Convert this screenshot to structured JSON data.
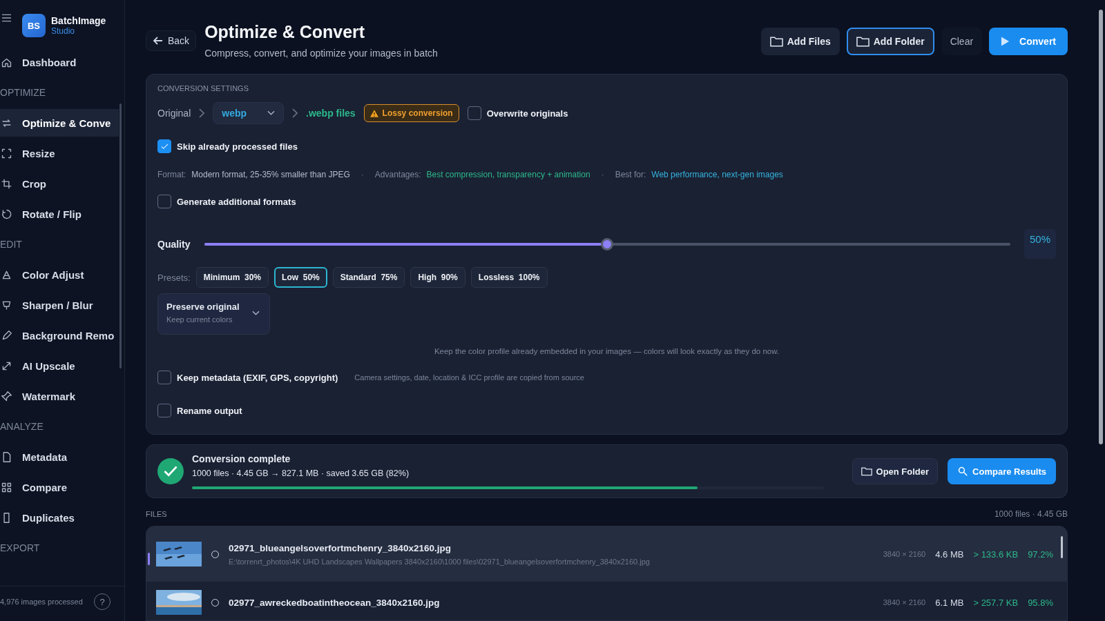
{
  "sidebar": {
    "brand": {
      "initials": "BS",
      "name": "BatchImage",
      "subtitle": "Studio"
    },
    "items": [
      {
        "kind": "item",
        "label": "Dashboard",
        "selected": false
      },
      {
        "kind": "section",
        "label": "OPTIMIZE"
      },
      {
        "kind": "item",
        "label": "Optimize & Conve",
        "selected": true
      },
      {
        "kind": "item",
        "label": "Resize",
        "selected": false
      },
      {
        "kind": "item",
        "label": "Crop",
        "selected": false
      },
      {
        "kind": "item",
        "label": "Rotate / Flip",
        "selected": false
      },
      {
        "kind": "section",
        "label": "EDIT"
      },
      {
        "kind": "item",
        "label": "Color Adjust",
        "selected": false
      },
      {
        "kind": "item",
        "label": "Sharpen / Blur",
        "selected": false
      },
      {
        "kind": "item",
        "label": "Background Remo",
        "selected": false
      },
      {
        "kind": "item",
        "label": "AI Upscale",
        "selected": false
      },
      {
        "kind": "item",
        "label": "Watermark",
        "selected": false
      },
      {
        "kind": "section",
        "label": "ANALYZE"
      },
      {
        "kind": "item",
        "label": "Metadata",
        "selected": false
      },
      {
        "kind": "item",
        "label": "Compare",
        "selected": false
      },
      {
        "kind": "item",
        "label": "Duplicates",
        "selected": false
      },
      {
        "kind": "section",
        "label": "EXPORT"
      }
    ],
    "footer": "4,976 images processed",
    "help": "?"
  },
  "header": {
    "back": "Back",
    "title": "Optimize & Convert",
    "subtitle": "Compress, convert, and optimize your images in batch",
    "buttons": [
      {
        "kind": "secondary",
        "label": "Add Files"
      },
      {
        "kind": "outlined",
        "label": "Add Folder"
      },
      {
        "kind": "ghost",
        "label": "Clear"
      },
      {
        "kind": "primary",
        "label": "Convert"
      }
    ]
  },
  "settings": {
    "title": "CONVERSION SETTINGS",
    "source": "Original",
    "format": "webp",
    "target": ".webp files",
    "badge": "Lossy conversion",
    "overwrite": {
      "label": "Overwrite originals",
      "checked": false
    },
    "skip": {
      "label": "Skip already processed files",
      "checked": true
    },
    "info": [
      {
        "label": "Format:",
        "value": "Modern format, 25-35% smaller than JPEG",
        "kind": "plain"
      },
      {
        "label": "Advantages:",
        "value": "Best compression, transparency + animation",
        "kind": "good"
      },
      {
        "label": "Best for:",
        "value": "Web performance, next-gen images",
        "kind": "link"
      }
    ],
    "separator": "·",
    "generate": {
      "label": "Generate additional formats",
      "checked": false
    },
    "quality": {
      "label": "Quality",
      "level": 0.5,
      "reading": "50%"
    },
    "presets_label": "Presets:",
    "presets": [
      {
        "name": "Minimum",
        "value": "30%",
        "selected": false
      },
      {
        "name": "Low",
        "value": "50%",
        "selected": true
      },
      {
        "name": "Standard",
        "value": "75%",
        "selected": false
      },
      {
        "name": "High",
        "value": "90%",
        "selected": false
      },
      {
        "name": "Lossless",
        "value": "100%",
        "selected": false
      }
    ],
    "color_profile": {
      "title": "Preserve original",
      "subtitle": "Keep current colors"
    },
    "color_note": "Keep the color profile already embedded in your images — colors will look exactly as they do now.",
    "metadata": {
      "label": "Keep metadata (EXIF, GPS, copyright)",
      "checked": false,
      "hint": "Camera settings, date, location & ICC profile are copied from source"
    },
    "rename": {
      "label": "Rename output",
      "checked": false
    }
  },
  "result": {
    "title": "Conversion complete",
    "summary": "1000 files · 4.45 GB → 827.1 MB · saved 3.65 GB (82%)",
    "level": 0.8,
    "buttons": [
      {
        "kind": "secondary",
        "label": "Open Folder"
      },
      {
        "kind": "primary",
        "label": "Compare Results"
      }
    ]
  },
  "files": {
    "title": "FILES",
    "summary": "1000 files · 4.45 GB",
    "rows": [
      {
        "name": "02971_blueangelsoverfortmchenry_3840x2160.jpg",
        "path": "E:\\torrenrt_photos\\4K UHD Landscapes Wallpapers 3840x2160\\1000 files\\02971_blueangelsoverfortmchenry_3840x2160.jpg",
        "dims": "3840 × 2160",
        "size": "4.6 MB",
        "new_size": "> 133.6 KB",
        "saving": "97.2%",
        "selected": true
      },
      {
        "name": "02977_awreckedboatintheocean_3840x2160.jpg",
        "dims": "3840 × 2160",
        "size": "6.1 MB",
        "new_size": "> 257.7 KB",
        "saving": "95.8%",
        "selected": false
      }
    ]
  }
}
